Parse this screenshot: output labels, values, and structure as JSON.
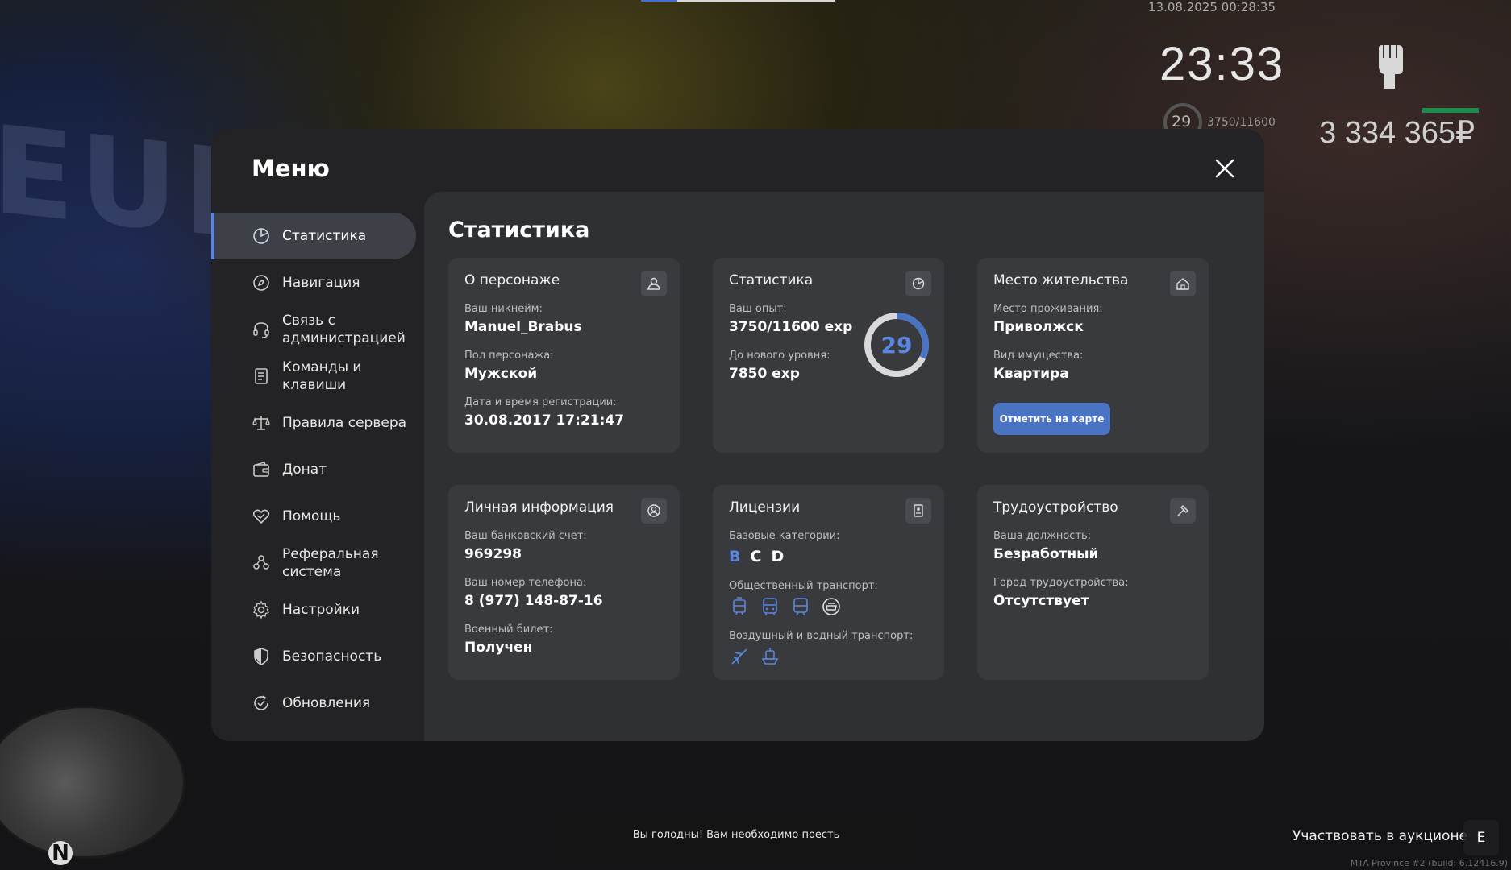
{
  "hud": {
    "date": "13.08.2025 00:28:35",
    "time": "23:33",
    "level": "29",
    "exp": "3750/11600",
    "money": "3 334 365₽"
  },
  "menu": {
    "title": "Меню",
    "sidebar": [
      {
        "label": "Статистика",
        "icon": "pie-chart-icon",
        "active": true
      },
      {
        "label": "Навигация",
        "icon": "compass-icon"
      },
      {
        "label": "Связь с администрацией",
        "icon": "headset-icon"
      },
      {
        "label": "Команды и клавиши",
        "icon": "document-icon"
      },
      {
        "label": "Правила сервера",
        "icon": "scales-icon"
      },
      {
        "label": "Донат",
        "icon": "wallet-icon"
      },
      {
        "label": "Помощь",
        "icon": "heart-hands-icon"
      },
      {
        "label": "Реферальная система",
        "icon": "people-icon"
      },
      {
        "label": "Настройки",
        "icon": "gear-icon"
      },
      {
        "label": "Безопасность",
        "icon": "shield-icon"
      },
      {
        "label": "Обновления",
        "icon": "refresh-check-icon"
      }
    ]
  },
  "content": {
    "title": "Статистика",
    "character": {
      "title": "О персонаже",
      "nickname_label": "Ваш никнейм:",
      "nickname": "Manuel_Brabus",
      "gender_label": "Пол персонажа:",
      "gender": "Мужской",
      "reg_label": "Дата и время регистрации:",
      "reg": "30.08.2017 17:21:47"
    },
    "stats": {
      "title": "Статистика",
      "exp_label": "Ваш опыт:",
      "exp": "3750/11600 exp",
      "next_label": "До нового уровня:",
      "next": "7850 exp",
      "level": "29",
      "progress": 0.323
    },
    "residence": {
      "title": "Место жительства",
      "place_label": "Место проживания:",
      "place": "Приволжск",
      "property_label": "Вид имущества:",
      "property": "Квартира",
      "button": "Отметить на карте"
    },
    "personal": {
      "title": "Личная информация",
      "bank_label": "Ваш банковский счет:",
      "bank": "969298",
      "phone_label": "Ваш номер телефона:",
      "phone": "8 (977) 148-87-16",
      "military_label": "Военный билет:",
      "military": "Получен"
    },
    "licenses": {
      "title": "Лицензии",
      "base_label": "Базовые категории:",
      "cat_b": "B",
      "cat_c": "C",
      "cat_d": "D",
      "public_label": "Общественный транспорт:",
      "air_label": "Воздушный и водный транспорт:"
    },
    "employment": {
      "title": "Трудоустройство",
      "position_label": "Ваша должность:",
      "position": "Безработный",
      "city_label": "Город трудоустройства:",
      "city": "Отсутствует"
    }
  },
  "notice": "Вы голодны! Вам необходимо поесть",
  "auction": {
    "label": "Участвовать в аукционе",
    "key": "E"
  },
  "build": "MTA Province #2 (build: 6.12416.9)",
  "colors": {
    "accent": "#5a86e0",
    "button": "#4a73c4",
    "panel": "#232325",
    "card": "#393a3d"
  }
}
